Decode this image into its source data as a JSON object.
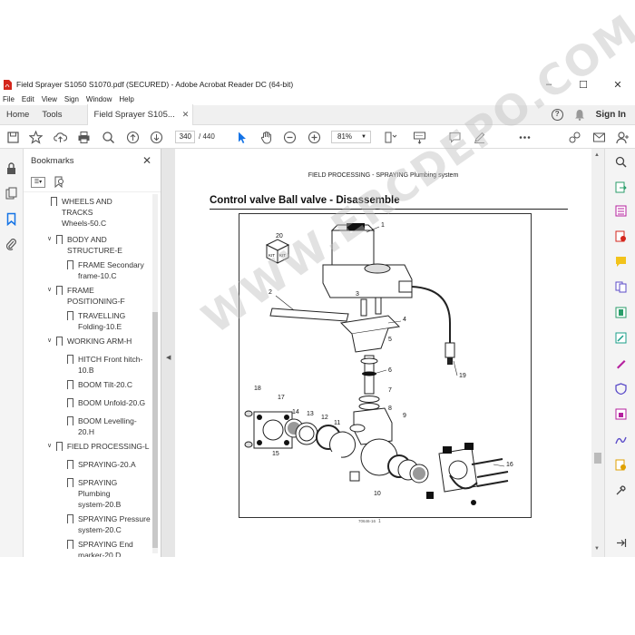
{
  "window": {
    "title": "Field Sprayer S1050 S1070.pdf (SECURED) - Adobe Acrobat Reader DC (64-bit)",
    "minimize": "–",
    "maximize": "☐",
    "close": "✕"
  },
  "menu": [
    "File",
    "Edit",
    "View",
    "Sign",
    "Window",
    "Help"
  ],
  "tabs": {
    "home": "Home",
    "tools": "Tools",
    "document": "Field Sprayer S105...",
    "close": "✕",
    "sign_in": "Sign In"
  },
  "toolbar": {
    "current_page": "340",
    "total_pages": "/ 440",
    "zoom": "81%"
  },
  "bookmarks": {
    "header": "Bookmarks",
    "close": "✕",
    "items": [
      {
        "label": "WHEELS AND",
        "level": 2
      },
      {
        "label": "TRACKS",
        "level": 2
      },
      {
        "label": "Wheels-50.C",
        "level": 2
      },
      {
        "label": "BODY AND STRUCTURE-E",
        "level": 1,
        "expanded": true
      },
      {
        "label": "FRAME Secondary frame-10.C",
        "level": 2
      },
      {
        "label": "FRAME POSITIONING-F",
        "level": 1,
        "expanded": true
      },
      {
        "label": "TRAVELLING Folding-10.E",
        "level": 2
      },
      {
        "label": "WORKING ARM-H",
        "level": 1,
        "expanded": true
      },
      {
        "label": "HITCH Front hitch-10.B",
        "level": 2
      },
      {
        "label": "BOOM Tilt-20.C",
        "level": 2
      },
      {
        "label": "BOOM Unfold-20.G",
        "level": 2
      },
      {
        "label": "BOOM Levelling-20.H",
        "level": 2
      },
      {
        "label": "FIELD PROCESSING-L",
        "level": 1,
        "expanded": true
      },
      {
        "label": "SPRAYING-20.A",
        "level": 2
      },
      {
        "label": "SPRAYING Plumbing system-20.B",
        "level": 2
      },
      {
        "label": "SPRAYING Pressure system-20.C",
        "level": 2
      },
      {
        "label": "SPRAYING End marker-20.D",
        "level": 2
      }
    ]
  },
  "document": {
    "section_header": "FIELD PROCESSING - SPRAYING Plumbing system",
    "title": "Control valve Ball valve - Disassemble",
    "figure_id": "70646-16",
    "figure_page": "1",
    "watermark": "WWW.ERCDEPO.COM",
    "part_numbers": [
      "20",
      "1",
      "2",
      "3",
      "4",
      "5",
      "6",
      "7",
      "8",
      "9",
      "10",
      "11",
      "12",
      "13",
      "14",
      "15",
      "16",
      "17",
      "18",
      "19"
    ],
    "kit_label": "KIT"
  },
  "colors": {
    "accent_red": "#d4261c",
    "nav_blue": "#1473e6"
  }
}
